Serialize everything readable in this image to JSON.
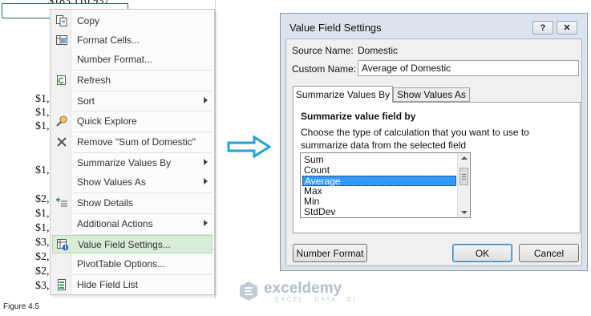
{
  "sheet": {
    "top_partial": "$183,110,937",
    "values": [
      "$1,",
      "$1,",
      "$1,",
      "$1,",
      "$2,",
      "$1,",
      "$1,",
      "$3,",
      "$2,",
      "$2,",
      "$3,"
    ],
    "figure_label": "Figure 4.5"
  },
  "context_menu": {
    "items": [
      {
        "label": "Copy",
        "icon": "copy-icon"
      },
      {
        "label": "Format Cells...",
        "icon": "format-cells-icon"
      },
      {
        "label": "Number Format...",
        "icon": ""
      },
      {
        "label": "Refresh",
        "icon": "refresh-icon"
      },
      {
        "label": "Sort",
        "icon": "",
        "submenu": true
      },
      {
        "label": "Quick Explore",
        "icon": "quick-explore-icon"
      },
      {
        "label": "Remove \"Sum of Domestic\"",
        "icon": "remove-x-icon"
      },
      {
        "label": "Summarize Values By",
        "icon": "",
        "submenu": true
      },
      {
        "label": "Show Values As",
        "icon": "",
        "submenu": true
      },
      {
        "label": "Show Details",
        "icon": "show-details-icon"
      },
      {
        "label": "Additional Actions",
        "icon": "",
        "submenu": true
      },
      {
        "label": "Value Field Settings...",
        "icon": "value-field-settings-icon",
        "active": true
      },
      {
        "label": "PivotTable Options...",
        "icon": ""
      },
      {
        "label": "Hide Field List",
        "icon": "field-list-icon"
      }
    ],
    "active_color": "#d9ecd7"
  },
  "arrow": {
    "color": "#1fa3dc",
    "icon": "right-arrow-icon"
  },
  "dialog": {
    "title": "Value Field Settings",
    "help_glyph": "?",
    "close_glyph": "✕",
    "source_name_label": "Source Name:",
    "source_name_value": "Domestic",
    "custom_name_label": "Custom Name:",
    "custom_name_value": "Average of Domestic",
    "tabs": [
      "Summarize Values By",
      "Show Values As"
    ],
    "section_heading": "Summarize value field by",
    "description": "Choose the type of calculation that you want to use to summarize data from the selected field",
    "functions": [
      "Sum",
      "Count",
      "Average",
      "Max",
      "Min",
      "StdDev"
    ],
    "selected_function": "Average",
    "buttons": {
      "number_format": "Number Format",
      "ok": "OK",
      "cancel": "Cancel"
    }
  },
  "watermark": {
    "name": "exceldemy",
    "tagline": "EXCEL · DATA · BI"
  }
}
